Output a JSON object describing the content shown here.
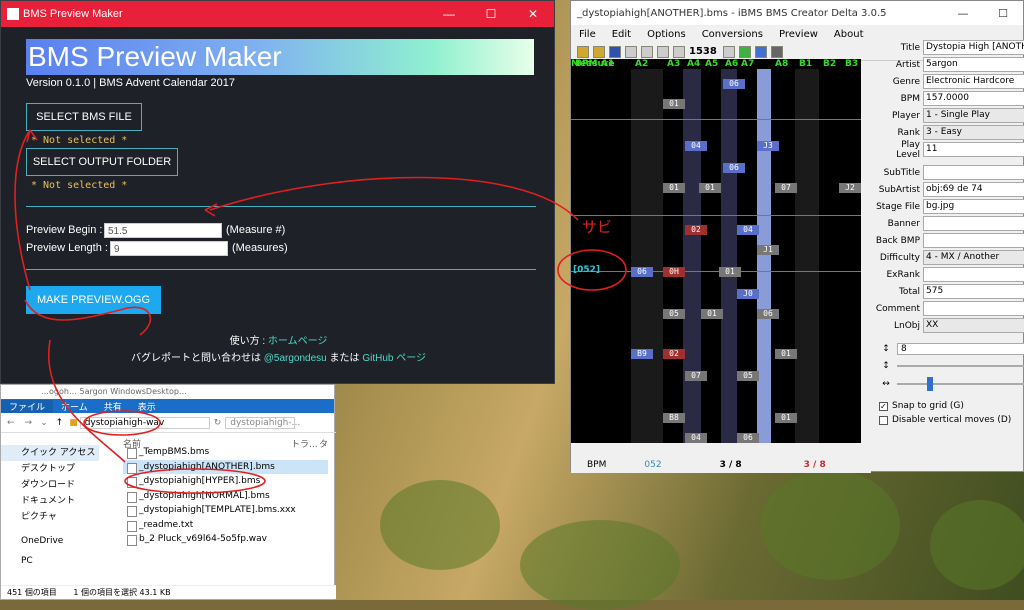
{
  "preview_window": {
    "title": "BMS Preview Maker",
    "controls": [
      "—",
      "☐",
      "✕"
    ],
    "banner": "BMS Preview Maker",
    "version": "Version 0.1.0 | BMS Advent Calendar 2017",
    "select_bms_label": "SELECT BMS FILE",
    "bms_status": "* Not selected *",
    "select_output_label": "SELECT OUTPUT FOLDER",
    "output_status": "* Not selected *",
    "begin_label": "Preview Begin :",
    "begin_value": "51.5",
    "begin_unit": "(Measure #)",
    "length_label": "Preview Length :",
    "length_value": "9",
    "length_unit": "(Measures)",
    "make_label": "MAKE PREVIEW.OGG",
    "usage_prefix": "使い方 : ",
    "usage_link": "ホームページ",
    "contact_prefix": "バグレポートと問い合わせは ",
    "contact_user": "@5argondesu",
    "contact_mid": " または ",
    "contact_link": "GitHub ページ"
  },
  "annotation": {
    "sabi": "サビ"
  },
  "explorer": {
    "path_title": "…ogoh… 5argon WindowsDesktop…",
    "tabs": [
      "ファイル",
      "ホーム",
      "共有",
      "表示"
    ],
    "address": "dystopiahigh-wav",
    "search": "dystopiahigh-...",
    "col_name": "名前",
    "col_more": "トラ...",
    "col_t": "タ",
    "sidebar": [
      "クイック アクセス",
      "デスクトップ",
      "ダウンロード",
      "ドキュメント",
      "ピクチャ",
      "OneDrive",
      "PC"
    ],
    "files": [
      "_TempBMS.bms",
      "_dystopiahigh[ANOTHER].bms",
      "_dystopiahigh[HYPER].bms",
      "_dystopiahigh[NORMAL].bms",
      "_dystopiahigh[TEMPLATE].bms.xxx",
      "_readme.txt",
      "b_2 Pluck_v69l64-5o5fp.wav"
    ],
    "status_count": "451 個の項目",
    "status_sel": "1 個の項目を選択  43.1 KB"
  },
  "ibms": {
    "title": "_dystopiahigh[ANOTHER].bms - iBMS BMS Creator Delta 3.0.5",
    "menu": [
      "File",
      "Edit",
      "Options",
      "Conversions",
      "Preview",
      "About"
    ],
    "tool_value": "1538",
    "lanes": [
      "Measure",
      "BPM",
      "A1",
      "A2",
      "A3",
      "A4",
      "A5",
      "A6",
      "A7",
      "A8",
      "B1",
      "B2",
      "B3"
    ],
    "measure_label": "[052]",
    "notes": [
      {
        "t": "06",
        "c": "b"
      },
      {
        "t": "01",
        "c": "w"
      },
      {
        "t": "04",
        "c": "b"
      },
      {
        "t": "J3",
        "c": "b"
      },
      {
        "t": "06",
        "c": "b"
      },
      {
        "t": "01",
        "c": "w"
      },
      {
        "t": "01",
        "c": "w"
      },
      {
        "t": "07",
        "c": "w"
      },
      {
        "t": "J2",
        "c": "w"
      },
      {
        "t": "02",
        "c": "r"
      },
      {
        "t": "04",
        "c": "b"
      },
      {
        "t": "J1",
        "c": "w"
      },
      {
        "t": "06",
        "c": "b"
      },
      {
        "t": "0H",
        "c": "r"
      },
      {
        "t": "01",
        "c": "w"
      },
      {
        "t": "J0",
        "c": "b"
      },
      {
        "t": "05",
        "c": "w"
      },
      {
        "t": "01",
        "c": "w"
      },
      {
        "t": "06",
        "c": "w"
      },
      {
        "t": "B9",
        "c": "b"
      },
      {
        "t": "02",
        "c": "r"
      },
      {
        "t": "01",
        "c": "w"
      },
      {
        "t": "07",
        "c": "w"
      },
      {
        "t": "05",
        "c": "w"
      },
      {
        "t": "B8",
        "c": "w"
      },
      {
        "t": "01",
        "c": "w"
      },
      {
        "t": "04",
        "c": "w"
      },
      {
        "t": "06",
        "c": "w"
      },
      {
        "t": "B7",
        "c": "w"
      }
    ],
    "bottom_bpm": "BPM",
    "bottom_measure": "052",
    "bottom_a": "3 / 8",
    "bottom_b": "3 / 8",
    "props": [
      {
        "k": "Title",
        "v": "Dystopia High [ANOTHER]"
      },
      {
        "k": "Artist",
        "v": "5argon"
      },
      {
        "k": "Genre",
        "v": "Electronic Hardcore"
      },
      {
        "k": "BPM",
        "v": "157.0000"
      },
      {
        "k": "Player",
        "v": "1 - Single Play",
        "g": true
      },
      {
        "k": "Rank",
        "v": "3 - Easy",
        "g": true
      },
      {
        "k": "Play Level",
        "v": "11"
      },
      {
        "k": "SubTitle",
        "v": ""
      },
      {
        "k": "SubArtist",
        "v": "obj:69 de 74"
      },
      {
        "k": "Stage File",
        "v": "bg.jpg"
      },
      {
        "k": "Banner",
        "v": ""
      },
      {
        "k": "Back BMP",
        "v": ""
      },
      {
        "k": "Difficulty",
        "v": "4 - MX / Another",
        "g": true
      },
      {
        "k": "ExRank",
        "v": ""
      },
      {
        "k": "Total",
        "v": "575"
      },
      {
        "k": "Comment",
        "v": ""
      },
      {
        "k": "LnObj",
        "v": "XX",
        "g": true
      }
    ],
    "grid_value": "8",
    "snap_label": "Snap to grid (G)",
    "disable_label": "Disable vertical moves (D)"
  }
}
